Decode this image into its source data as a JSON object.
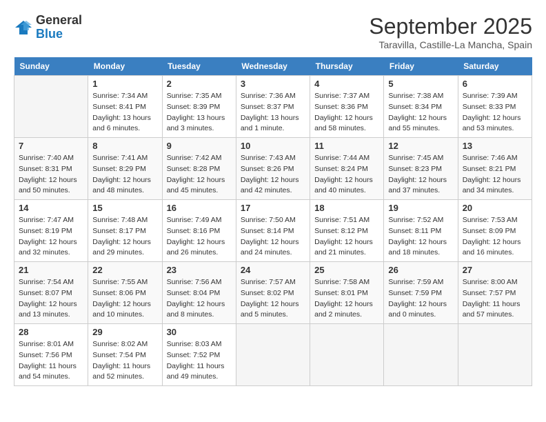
{
  "logo": {
    "general": "General",
    "blue": "Blue"
  },
  "header": {
    "month": "September 2025",
    "location": "Taravilla, Castille-La Mancha, Spain"
  },
  "weekdays": [
    "Sunday",
    "Monday",
    "Tuesday",
    "Wednesday",
    "Thursday",
    "Friday",
    "Saturday"
  ],
  "weeks": [
    [
      {
        "day": "",
        "empty": true
      },
      {
        "day": "1",
        "sunrise": "7:34 AM",
        "sunset": "8:41 PM",
        "daylight": "13 hours and 6 minutes."
      },
      {
        "day": "2",
        "sunrise": "7:35 AM",
        "sunset": "8:39 PM",
        "daylight": "13 hours and 3 minutes."
      },
      {
        "day": "3",
        "sunrise": "7:36 AM",
        "sunset": "8:37 PM",
        "daylight": "13 hours and 1 minute."
      },
      {
        "day": "4",
        "sunrise": "7:37 AM",
        "sunset": "8:36 PM",
        "daylight": "12 hours and 58 minutes."
      },
      {
        "day": "5",
        "sunrise": "7:38 AM",
        "sunset": "8:34 PM",
        "daylight": "12 hours and 55 minutes."
      },
      {
        "day": "6",
        "sunrise": "7:39 AM",
        "sunset": "8:33 PM",
        "daylight": "12 hours and 53 minutes."
      }
    ],
    [
      {
        "day": "7",
        "sunrise": "7:40 AM",
        "sunset": "8:31 PM",
        "daylight": "12 hours and 50 minutes."
      },
      {
        "day": "8",
        "sunrise": "7:41 AM",
        "sunset": "8:29 PM",
        "daylight": "12 hours and 48 minutes."
      },
      {
        "day": "9",
        "sunrise": "7:42 AM",
        "sunset": "8:28 PM",
        "daylight": "12 hours and 45 minutes."
      },
      {
        "day": "10",
        "sunrise": "7:43 AM",
        "sunset": "8:26 PM",
        "daylight": "12 hours and 42 minutes."
      },
      {
        "day": "11",
        "sunrise": "7:44 AM",
        "sunset": "8:24 PM",
        "daylight": "12 hours and 40 minutes."
      },
      {
        "day": "12",
        "sunrise": "7:45 AM",
        "sunset": "8:23 PM",
        "daylight": "12 hours and 37 minutes."
      },
      {
        "day": "13",
        "sunrise": "7:46 AM",
        "sunset": "8:21 PM",
        "daylight": "12 hours and 34 minutes."
      }
    ],
    [
      {
        "day": "14",
        "sunrise": "7:47 AM",
        "sunset": "8:19 PM",
        "daylight": "12 hours and 32 minutes."
      },
      {
        "day": "15",
        "sunrise": "7:48 AM",
        "sunset": "8:17 PM",
        "daylight": "12 hours and 29 minutes."
      },
      {
        "day": "16",
        "sunrise": "7:49 AM",
        "sunset": "8:16 PM",
        "daylight": "12 hours and 26 minutes."
      },
      {
        "day": "17",
        "sunrise": "7:50 AM",
        "sunset": "8:14 PM",
        "daylight": "12 hours and 24 minutes."
      },
      {
        "day": "18",
        "sunrise": "7:51 AM",
        "sunset": "8:12 PM",
        "daylight": "12 hours and 21 minutes."
      },
      {
        "day": "19",
        "sunrise": "7:52 AM",
        "sunset": "8:11 PM",
        "daylight": "12 hours and 18 minutes."
      },
      {
        "day": "20",
        "sunrise": "7:53 AM",
        "sunset": "8:09 PM",
        "daylight": "12 hours and 16 minutes."
      }
    ],
    [
      {
        "day": "21",
        "sunrise": "7:54 AM",
        "sunset": "8:07 PM",
        "daylight": "12 hours and 13 minutes."
      },
      {
        "day": "22",
        "sunrise": "7:55 AM",
        "sunset": "8:06 PM",
        "daylight": "12 hours and 10 minutes."
      },
      {
        "day": "23",
        "sunrise": "7:56 AM",
        "sunset": "8:04 PM",
        "daylight": "12 hours and 8 minutes."
      },
      {
        "day": "24",
        "sunrise": "7:57 AM",
        "sunset": "8:02 PM",
        "daylight": "12 hours and 5 minutes."
      },
      {
        "day": "25",
        "sunrise": "7:58 AM",
        "sunset": "8:01 PM",
        "daylight": "12 hours and 2 minutes."
      },
      {
        "day": "26",
        "sunrise": "7:59 AM",
        "sunset": "7:59 PM",
        "daylight": "12 hours and 0 minutes."
      },
      {
        "day": "27",
        "sunrise": "8:00 AM",
        "sunset": "7:57 PM",
        "daylight": "11 hours and 57 minutes."
      }
    ],
    [
      {
        "day": "28",
        "sunrise": "8:01 AM",
        "sunset": "7:56 PM",
        "daylight": "11 hours and 54 minutes."
      },
      {
        "day": "29",
        "sunrise": "8:02 AM",
        "sunset": "7:54 PM",
        "daylight": "11 hours and 52 minutes."
      },
      {
        "day": "30",
        "sunrise": "8:03 AM",
        "sunset": "7:52 PM",
        "daylight": "11 hours and 49 minutes."
      },
      {
        "day": "",
        "empty": true
      },
      {
        "day": "",
        "empty": true
      },
      {
        "day": "",
        "empty": true
      },
      {
        "day": "",
        "empty": true
      }
    ]
  ],
  "labels": {
    "sunrise": "Sunrise:",
    "sunset": "Sunset:",
    "daylight": "Daylight:"
  }
}
